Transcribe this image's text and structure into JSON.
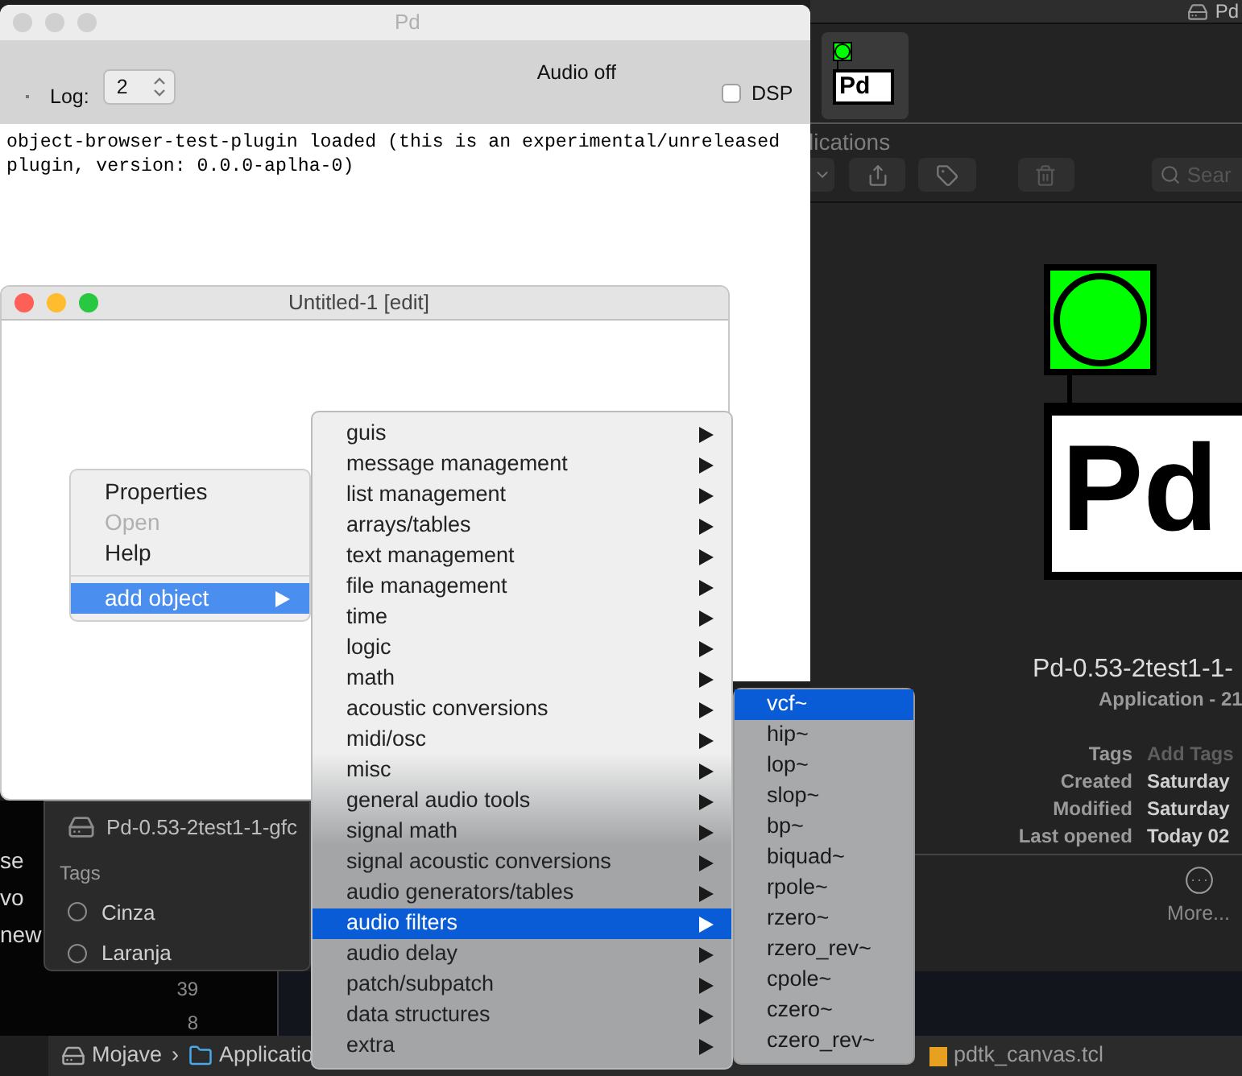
{
  "backdrop": {
    "fragments": [
      "se",
      "vo",
      "new"
    ],
    "numbers": [
      "39",
      "8"
    ]
  },
  "finder_sidebar": {
    "volume": "Pd-0.53-2test1-1-gfc",
    "tags_heading": "Tags",
    "tags": [
      {
        "label": "Cinza"
      },
      {
        "label": "Laranja"
      }
    ]
  },
  "path_bar": {
    "crumbs": [
      {
        "kind": "disk",
        "label": "Mojave"
      },
      {
        "kind": "separator",
        "label": "›"
      },
      {
        "kind": "folder",
        "label": "Applicatio"
      }
    ],
    "file": "pdtk_canvas.tcl"
  },
  "info_window": {
    "title": "Pd",
    "thumbnail_text": "Pd",
    "section": "lications",
    "search_placeholder": "Sear",
    "logo_text": "Pd",
    "name": "Pd-0.53-2test1-1-",
    "subtitle": "Application - 21",
    "details": [
      {
        "label": "Tags",
        "value": "Add Tags",
        "placeholder": true
      },
      {
        "label": "Created",
        "value": "Saturday",
        "placeholder": false
      },
      {
        "label": "Modified",
        "value": "Saturday",
        "placeholder": false
      },
      {
        "label": "Last opened",
        "value": "Today 02",
        "placeholder": false
      }
    ],
    "more": "More..."
  },
  "pd_window": {
    "title": "Pd",
    "focused": false,
    "log_label": "Log:",
    "log_value": "2",
    "audio_status": "Audio off",
    "dsp": {
      "label": "DSP",
      "checked": false
    },
    "console": "object-browser-test-plugin loaded (this is an experimental/unreleased plugin, version: 0.0.0-aplha-0)"
  },
  "patch_window": {
    "title": "Untitled-1 [edit]",
    "focused": true
  },
  "context_menu": {
    "items": [
      {
        "kind": "item",
        "label": "Properties",
        "disabled": false,
        "selected": false,
        "has_submenu": false
      },
      {
        "kind": "item",
        "label": "Open",
        "disabled": true,
        "selected": false,
        "has_submenu": false
      },
      {
        "kind": "item",
        "label": "Help",
        "disabled": false,
        "selected": false,
        "has_submenu": false
      },
      {
        "kind": "separator"
      },
      {
        "kind": "item",
        "label": "add object",
        "disabled": false,
        "selected": true,
        "has_submenu": true
      }
    ]
  },
  "object_menu": {
    "items": [
      {
        "label": "guis",
        "selected": false,
        "has_submenu": true
      },
      {
        "label": "message management",
        "selected": false,
        "has_submenu": true
      },
      {
        "label": "list management",
        "selected": false,
        "has_submenu": true
      },
      {
        "label": "arrays/tables",
        "selected": false,
        "has_submenu": true
      },
      {
        "label": "text management",
        "selected": false,
        "has_submenu": true
      },
      {
        "label": "file management",
        "selected": false,
        "has_submenu": true
      },
      {
        "label": "time",
        "selected": false,
        "has_submenu": true
      },
      {
        "label": "logic",
        "selected": false,
        "has_submenu": true
      },
      {
        "label": "math",
        "selected": false,
        "has_submenu": true
      },
      {
        "label": "acoustic conversions",
        "selected": false,
        "has_submenu": true
      },
      {
        "label": "midi/osc",
        "selected": false,
        "has_submenu": true
      },
      {
        "label": "misc",
        "selected": false,
        "has_submenu": true
      },
      {
        "label": "general audio tools",
        "selected": false,
        "has_submenu": true
      },
      {
        "label": "signal math",
        "selected": false,
        "has_submenu": true
      },
      {
        "label": "signal acoustic conversions",
        "selected": false,
        "has_submenu": true
      },
      {
        "label": "audio generators/tables",
        "selected": false,
        "has_submenu": true
      },
      {
        "label": "audio filters",
        "selected": true,
        "has_submenu": true
      },
      {
        "label": "audio delay",
        "selected": false,
        "has_submenu": true
      },
      {
        "label": "patch/subpatch",
        "selected": false,
        "has_submenu": true
      },
      {
        "label": "data structures",
        "selected": false,
        "has_submenu": true
      },
      {
        "label": "extra",
        "selected": false,
        "has_submenu": true
      }
    ]
  },
  "filter_menu": {
    "items": [
      {
        "label": "vcf~",
        "selected": true
      },
      {
        "label": "hip~",
        "selected": false
      },
      {
        "label": "lop~",
        "selected": false
      },
      {
        "label": "slop~",
        "selected": false
      },
      {
        "label": "bp~",
        "selected": false
      },
      {
        "label": "biquad~",
        "selected": false
      },
      {
        "label": "rpole~",
        "selected": false
      },
      {
        "label": "rzero~",
        "selected": false
      },
      {
        "label": "rzero_rev~",
        "selected": false
      },
      {
        "label": "cpole~",
        "selected": false
      },
      {
        "label": "czero~",
        "selected": false
      },
      {
        "label": "czero_rev~",
        "selected": false
      }
    ]
  }
}
